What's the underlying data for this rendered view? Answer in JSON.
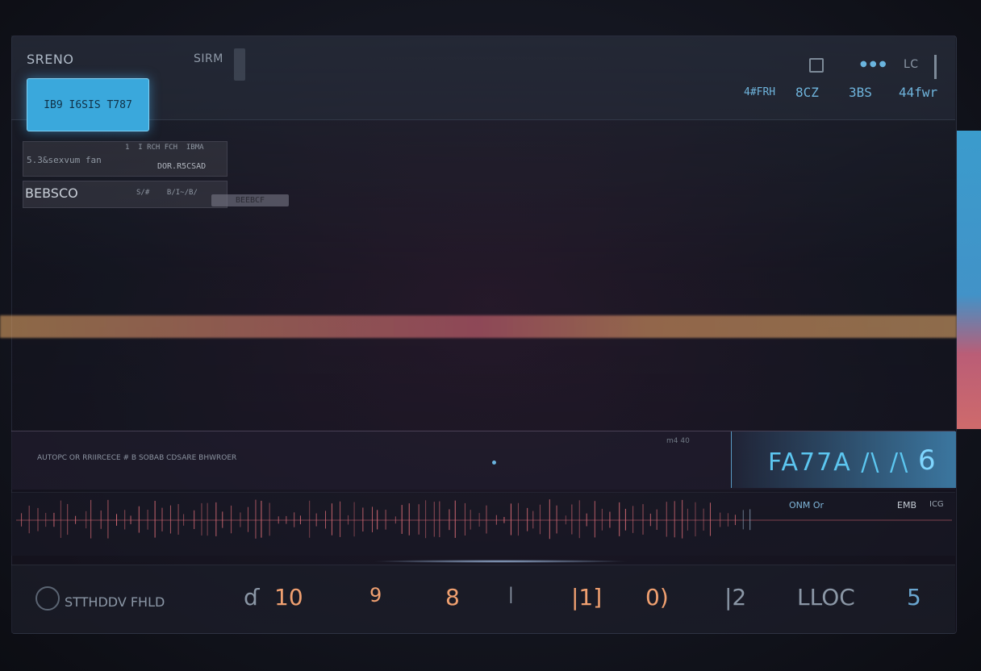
{
  "header": {
    "title": "SRENO",
    "mode_label": "SIRM",
    "top_right_icons": [
      "speaker-icon",
      "dots-icon"
    ],
    "top_right_text": "LC",
    "stats": [
      "4#FRH",
      "8CZ",
      "3BS",
      "44fwr"
    ]
  },
  "primary_button": {
    "label": "IB9 I6SIS T787"
  },
  "info": {
    "line1_right_top": "1  I RCH FCH  IBMA",
    "line1_left": "5.3&sexvum fan",
    "line1_right_bottom": "DOR.R5CSAD",
    "line2_left": "BEBSCO",
    "line2_right": "S/#    B/I~/B/",
    "small_tag": "BEEBCF"
  },
  "colors": {
    "accent_blue": "#3aa8dc",
    "wave_orange": "#f2b06a",
    "wave_pink": "#e0707c"
  },
  "track_info": {
    "left_text": "AUTOPC OR RRIIRCECE  #  B SOBAB CDSARE BHWROER",
    "top_mid": "m4 40",
    "big_label": "FA77A /\\ /\\",
    "big_glyph": "6"
  },
  "mini_wave_labels": {
    "a": "ONM Or",
    "b": "EMB",
    "c": "ICG"
  },
  "bottom": {
    "left_label": "STTHDDV FHLD",
    "numbers": [
      "ɗ",
      "10",
      "9",
      "8",
      "|",
      "|1]",
      "0)",
      "|2",
      "LLOC",
      "5"
    ]
  }
}
